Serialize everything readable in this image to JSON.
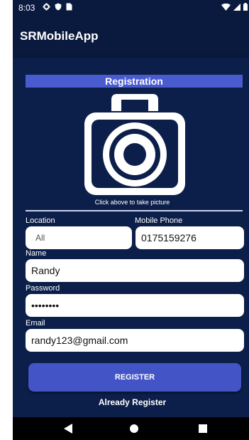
{
  "status_bar": {
    "time": "8:03",
    "left_icons": [
      "settings-icon",
      "shield-icon",
      "sim-card-icon"
    ],
    "right_icons": [
      "wifi-icon",
      "signal-icon",
      "battery-icon"
    ]
  },
  "app_bar": {
    "title": "SRMobileApp"
  },
  "registration": {
    "header": "Registration",
    "camera_caption": "Click above to take picture"
  },
  "form": {
    "location_label": "Location",
    "location_value": "All",
    "mobile_label": "Mobile Phone",
    "mobile_value": "0175159276",
    "name_label": "Name",
    "name_value": "Randy",
    "password_label": "Password",
    "password_value": "••••••••",
    "email_label": "Email",
    "email_value": "randy123@gmail.com"
  },
  "actions": {
    "register_label": "REGISTER",
    "already_label": "Already Register"
  },
  "nav_bar": {
    "buttons": [
      "back-icon",
      "home-icon",
      "recents-icon"
    ]
  },
  "colors": {
    "background": "#0c1f4a",
    "app_bar": "#0a1a3e",
    "accent": "#4a5bd0",
    "button": "#4354c7"
  }
}
